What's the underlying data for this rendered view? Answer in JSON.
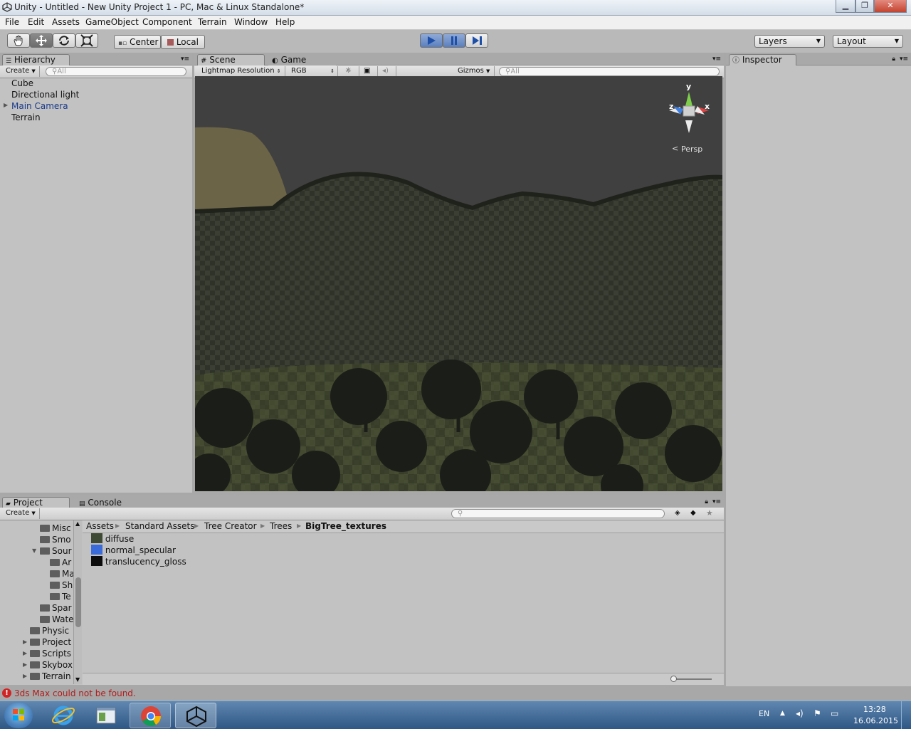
{
  "window": {
    "title": "Unity - Untitled - New Unity Project 1 - PC, Mac & Linux Standalone*",
    "buttons": [
      "minimize",
      "maximize",
      "close"
    ]
  },
  "menu": [
    "File",
    "Edit",
    "Assets",
    "GameObject",
    "Component",
    "Terrain",
    "Window",
    "Help"
  ],
  "toolbar": {
    "tools": [
      "hand-icon",
      "move-icon",
      "rotate-icon",
      "scale-icon"
    ],
    "pivot": "Center",
    "space": "Local",
    "play_controls": [
      "play-icon",
      "pause-icon",
      "step-icon"
    ],
    "layers": "Layers",
    "layout": "Layout"
  },
  "hierarchy": {
    "tab": "Hierarchy",
    "create": "Create",
    "search": "All",
    "items": [
      "Cube",
      "Directional light",
      "Main Camera",
      "Terrain"
    ],
    "selected_color": "#1a3a8a"
  },
  "scene": {
    "tab_scene": "Scene",
    "tab_game": "Game",
    "render_mode": "Lightmap Resolution",
    "color_mode": "RGB",
    "gizmos": "Gizmos",
    "search": "All",
    "gizmo_axes": {
      "y": "y",
      "x": "x",
      "z": "z"
    },
    "projection": "Persp"
  },
  "inspector": {
    "tab": "Inspector"
  },
  "project": {
    "tab_project": "Project",
    "tab_console": "Console",
    "create": "Create",
    "tree": [
      {
        "label": "Misc",
        "depth": 3
      },
      {
        "label": "Smo",
        "depth": 3
      },
      {
        "label": "Sour",
        "depth": 3
      },
      {
        "label": "Ar",
        "depth": 4
      },
      {
        "label": "Ma",
        "depth": 4
      },
      {
        "label": "Sh",
        "depth": 4
      },
      {
        "label": "Te",
        "depth": 4
      },
      {
        "label": "Spar",
        "depth": 3
      },
      {
        "label": "Wate",
        "depth": 3
      },
      {
        "label": "Physic",
        "depth": 2
      },
      {
        "label": "Project",
        "depth": 2
      },
      {
        "label": "Scripts",
        "depth": 2
      },
      {
        "label": "Skybox",
        "depth": 2
      },
      {
        "label": "Terrain",
        "depth": 2
      }
    ],
    "breadcrumb": [
      "Assets",
      "Standard Assets",
      "Tree Creator",
      "Trees",
      "BigTree_textures"
    ],
    "files": [
      {
        "name": "diffuse",
        "color": "#3e4a33"
      },
      {
        "name": "normal_specular",
        "color": "#3a6bd8"
      },
      {
        "name": "translucency_gloss",
        "color": "#0d0d0d"
      }
    ]
  },
  "status": {
    "message": "3ds Max could not be found."
  },
  "taskbar": {
    "lang": "EN",
    "time": "13:28",
    "date": "16.06.2015"
  }
}
